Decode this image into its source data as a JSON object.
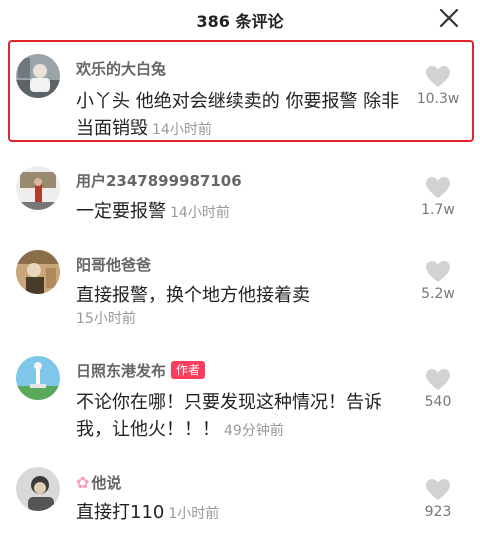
{
  "header": {
    "title": "386 条评论"
  },
  "comments": [
    {
      "user": "欢乐的大白兔",
      "text": "小丫头 他绝对会继续卖的 你要报警 除非当面销毁",
      "time": "14小时前",
      "likes": "10.3w",
      "highlighted": true
    },
    {
      "user": "用户2347899987106",
      "text": "一定要报警",
      "time": "14小时前",
      "likes": "1.7w"
    },
    {
      "user": "阳哥他爸爸",
      "text": "直接报警，换个地方他接着卖",
      "time": "15小时前",
      "likes": "5.2w"
    },
    {
      "user": "日照东港发布",
      "badge": "作者",
      "text": "不论你在哪！只要发现这种情况！告诉我，让他火！！！",
      "time": "49分钟前",
      "likes": "540"
    },
    {
      "user": "他说",
      "user_prefix": "✿",
      "text": "直接打110",
      "time": "1小时前",
      "likes": "923"
    }
  ]
}
